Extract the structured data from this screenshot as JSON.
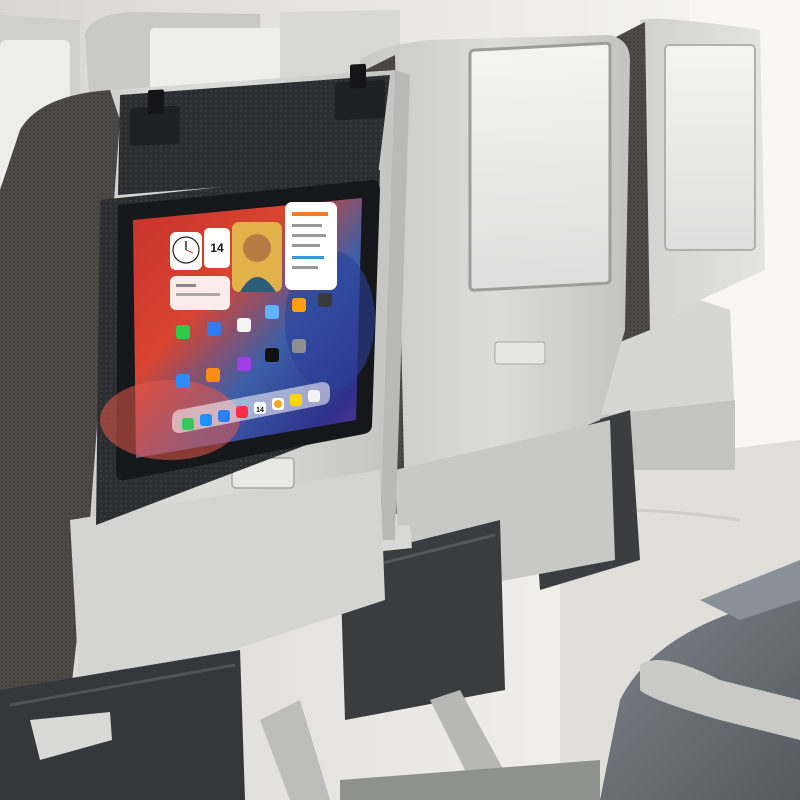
{
  "scene": {
    "description_visible_text": "",
    "colors": {
      "cabin_wall": "#ecebe7",
      "seat_shell": "#cfcfcd",
      "seat_fabric": "#4d4a46",
      "holder_fabric": "#2c2d30",
      "screen_bezel": "#1a1b1e",
      "seat_cushion": "#6f757c",
      "window_light": "#f6f5f1"
    }
  },
  "tablet": {
    "date_widget_day": "14",
    "calendar_icon_day": "14",
    "wallpaper_colors": [
      "#b22a2a",
      "#d8442f",
      "#3b5fa8",
      "#2f2f8a",
      "#6b3b9a"
    ],
    "apps": [
      {
        "name": "facetime-icon",
        "color": "#2fc94a"
      },
      {
        "name": "files-icon",
        "color": "#2e7df6"
      },
      {
        "name": "photos-icon",
        "color": "#f3f3f3"
      },
      {
        "name": "maps-icon",
        "color": "#5fb2ff"
      },
      {
        "name": "home-icon",
        "color": "#ff9f0a"
      },
      {
        "name": "camera-icon",
        "color": "#3a3a3c"
      },
      {
        "name": "app-store-icon",
        "color": "#2d8cff"
      },
      {
        "name": "books-icon",
        "color": "#ff8c1a"
      },
      {
        "name": "podcasts-icon",
        "color": "#a23ee8"
      },
      {
        "name": "apple-tv-icon",
        "color": "#111111"
      },
      {
        "name": "settings-icon",
        "color": "#8e8e93"
      }
    ],
    "dock": [
      {
        "name": "messages-icon",
        "color": "#34c759"
      },
      {
        "name": "safari-icon",
        "color": "#1e90ff"
      },
      {
        "name": "mail-icon",
        "color": "#2a7ff3"
      },
      {
        "name": "music-icon",
        "color": "#fa2d48"
      },
      {
        "name": "calendar-icon",
        "color": "#ffffff"
      },
      {
        "name": "photos-dock-icon",
        "color": "#ffffff"
      },
      {
        "name": "notes-icon",
        "color": "#ffd60a"
      },
      {
        "name": "reminders-icon",
        "color": "#f2f2f2"
      }
    ]
  }
}
